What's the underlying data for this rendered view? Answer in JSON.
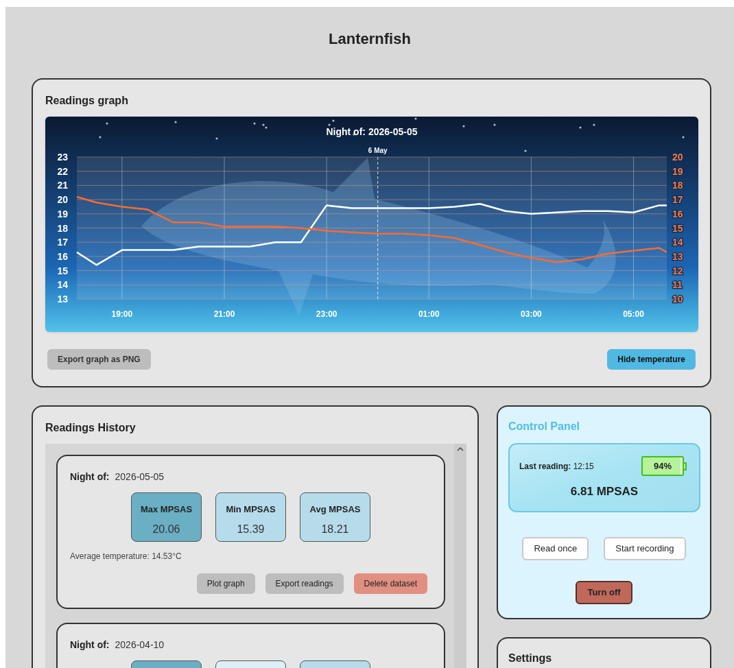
{
  "app_title": "Lanternfish",
  "graph_card": {
    "title": "Readings graph",
    "chart_data": {
      "type": "line",
      "title": "Night of: 2026-05-05",
      "x": [
        "2026-05-05T18:07",
        "2026-05-05T18:30",
        "2026-05-05T19:00",
        "2026-05-05T19:30",
        "2026-05-05T20:00",
        "2026-05-05T20:30",
        "2026-05-05T21:00",
        "2026-05-05T21:30",
        "2026-05-05T22:00",
        "2026-05-05T22:30",
        "2026-05-05T23:00",
        "2026-05-05T23:30",
        "2026-05-06T00:00",
        "2026-05-06T00:30",
        "2026-05-06T01:00",
        "2026-05-06T01:30",
        "2026-05-06T02:00",
        "2026-05-06T02:30",
        "2026-05-06T03:00",
        "2026-05-06T03:30",
        "2026-05-06T04:00",
        "2026-05-06T04:30",
        "2026-05-06T05:00",
        "2026-05-06T05:30",
        "2026-05-06T05:39"
      ],
      "series": [
        {
          "color": "#ffffff",
          "values": [
            16.3,
            15.4,
            16.45,
            16.45,
            16.45,
            16.7,
            16.7,
            16.7,
            17.0,
            17.0,
            19.6,
            19.4,
            19.4,
            19.4,
            19.4,
            19.5,
            19.7,
            19.2,
            19.0,
            19.1,
            19.2,
            19.2,
            19.1,
            19.6,
            19.6
          ]
        },
        {
          "color": "#ff6a2b",
          "axis": "y2",
          "values": [
            17.2,
            16.8,
            16.5,
            16.3,
            15.4,
            15.4,
            15.1,
            15.1,
            15.1,
            15.0,
            14.8,
            14.7,
            14.6,
            14.6,
            14.5,
            14.3,
            13.8,
            13.3,
            12.9,
            12.6,
            12.8,
            13.2,
            13.4,
            13.6,
            13.3
          ]
        }
      ],
      "xlim": [
        "2026-05-05T18:07",
        "2026-05-06T05:39"
      ],
      "ylim": [
        13,
        23
      ],
      "y2lim": [
        10,
        20
      ],
      "xticks": [
        {
          "value": "2026-05-05T19:00",
          "label": "19:00"
        },
        {
          "value": "2026-05-05T21:00",
          "label": "21:00"
        },
        {
          "value": "2026-05-05T23:00",
          "label": "23:00"
        },
        {
          "value": "2026-05-06T01:00",
          "label": "01:00"
        },
        {
          "value": "2026-05-06T03:00",
          "label": "03:00"
        },
        {
          "value": "2026-05-06T05:00",
          "label": "05:00"
        }
      ],
      "yticks": [
        13,
        14,
        15,
        16,
        17,
        18,
        19,
        20,
        21,
        22,
        23
      ],
      "y2ticks": [
        10,
        11,
        12,
        13,
        14,
        15,
        16,
        17,
        18,
        19,
        20
      ],
      "grid": true,
      "annotations": [
        {
          "x": "2026-05-06T00:00",
          "text": "6 May"
        }
      ]
    },
    "buttons": [
      "Export graph as PNG",
      "Hide temperature"
    ]
  },
  "history": {
    "title": "Readings History",
    "datasets": [
      {
        "night_label": "Night of:",
        "date": "2026-05-05",
        "stats": [
          {
            "label": "Max MPSAS",
            "value": "20.06",
            "color": "#6aafc4"
          },
          {
            "label": "Min MPSAS",
            "value": "15.39",
            "color": "#b6dcec"
          },
          {
            "label": "Avg MPSAS",
            "value": "18.21",
            "color": "#b6dcec"
          }
        ],
        "avg_temperature": "Average temperature: 14.53°C",
        "buttons": [
          {
            "label": "Plot graph",
            "kind": "neutral"
          },
          {
            "label": "Export readings",
            "kind": "neutral"
          },
          {
            "label": "Delete dataset",
            "kind": "danger"
          }
        ]
      },
      {
        "night_label": "Night of:",
        "date": "2026-04-10",
        "stats": [
          {
            "color": "#6aafc4"
          },
          {
            "color": "#dcf0f8"
          },
          {
            "color": "#b6dcec"
          }
        ]
      }
    ]
  },
  "control_panel": {
    "title": "Control Panel",
    "last_reading_label": "Last reading:",
    "last_reading_time": "12:15",
    "battery": {
      "text": "94%",
      "level": 0.94
    },
    "reading": "6.81 MPSAS",
    "buttons": [
      {
        "label": "Read once",
        "kind": "plain"
      },
      {
        "label": "Start recording",
        "kind": "plain"
      },
      {
        "label": "Turn off",
        "kind": "danger"
      }
    ]
  },
  "settings": {
    "title": "Settings"
  }
}
